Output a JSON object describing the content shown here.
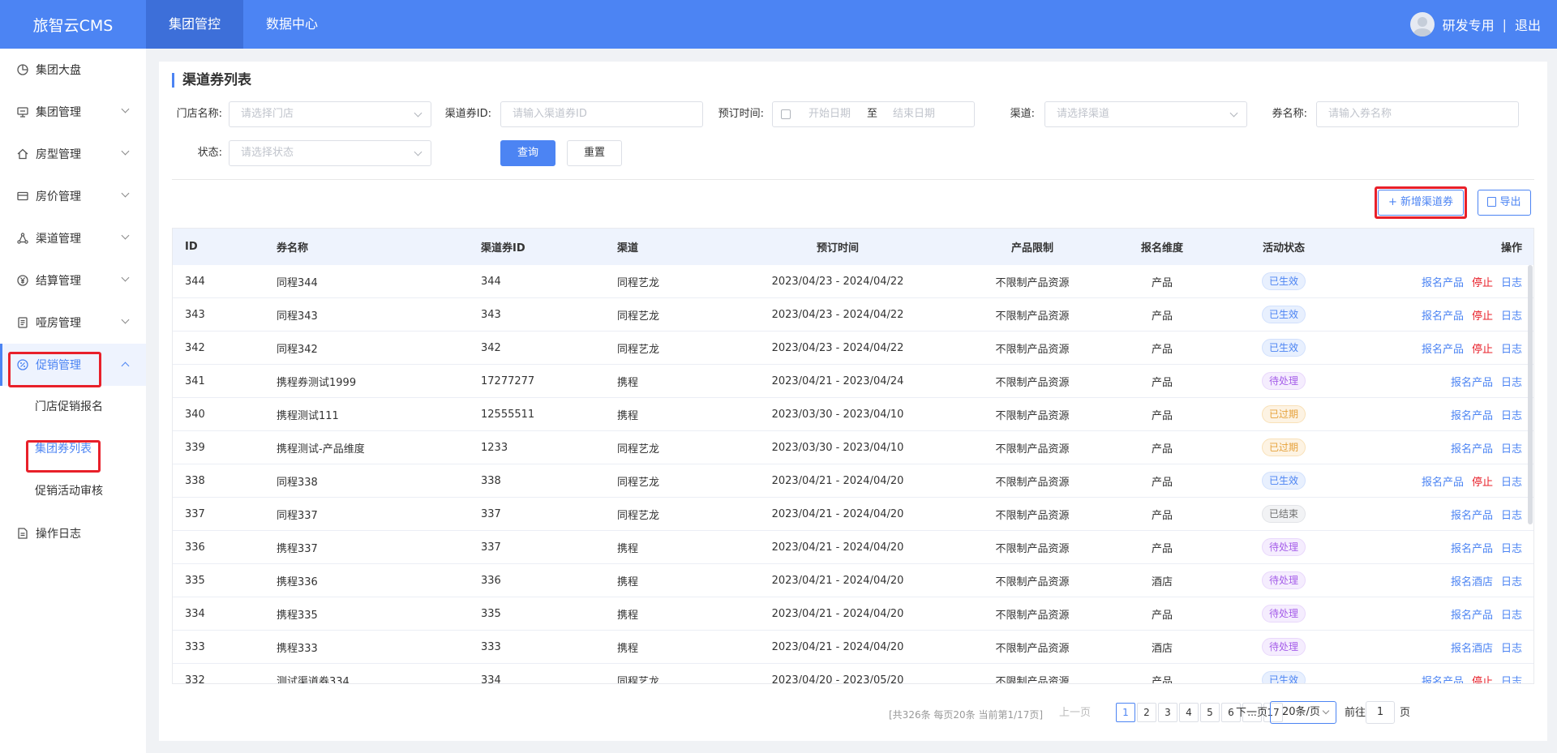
{
  "header": {
    "logo": "旅智云CMS",
    "nav": [
      {
        "label": "集团管控",
        "active": true
      },
      {
        "label": "数据中心",
        "active": false
      }
    ],
    "user_name": "研发专用",
    "separator": "|",
    "logout": "退出"
  },
  "sidebar": {
    "items": [
      {
        "label": "集团大盘",
        "icon": "pie-chart-icon"
      },
      {
        "label": "集团管理",
        "icon": "monitor-icon"
      },
      {
        "label": "房型管理",
        "icon": "home-icon"
      },
      {
        "label": "房价管理",
        "icon": "card-icon"
      },
      {
        "label": "渠道管理",
        "icon": "network-icon"
      },
      {
        "label": "结算管理",
        "icon": "yen-icon"
      },
      {
        "label": "哑房管理",
        "icon": "document-icon"
      },
      {
        "label": "促销管理",
        "icon": "promo-icon"
      }
    ],
    "submenu": [
      "门店促销报名",
      "集团券列表",
      "促销活动审核"
    ],
    "bottom_item": {
      "label": "操作日志",
      "icon": "log-icon"
    }
  },
  "page": {
    "title": "渠道券列表"
  },
  "filters": {
    "store_label": "门店名称:",
    "store_placeholder": "请选择门店",
    "coupon_id_label": "渠道券ID:",
    "coupon_id_placeholder": "请输入渠道券ID",
    "booking_label": "预订时间:",
    "start_placeholder": "开始日期",
    "to": "至",
    "end_placeholder": "结束日期",
    "channel_label": "渠道:",
    "channel_placeholder": "请选择渠道",
    "coupon_name_label": "券名称:",
    "coupon_name_placeholder": "请输入券名称",
    "status_label": "状态:",
    "status_placeholder": "请选择状态",
    "search_btn": "查询",
    "reset_btn": "重置"
  },
  "toolbar": {
    "add_btn": "+ 新增渠道券",
    "export_btn": "导出"
  },
  "table": {
    "columns": [
      "ID",
      "券名称",
      "渠道券ID",
      "渠道",
      "预订时间",
      "产品限制",
      "报名维度",
      "活动状态",
      "操作"
    ],
    "rows": [
      {
        "id": "344",
        "name": "同程344",
        "cid": "344",
        "channel": "同程艺龙",
        "time": "2023/04/23 - 2024/04/22",
        "limit": "不限制产品资源",
        "dim": "产品",
        "status": "已生效",
        "status_type": "blue",
        "ops": [
          "报名产品",
          "停止",
          "日志"
        ]
      },
      {
        "id": "343",
        "name": "同程343",
        "cid": "343",
        "channel": "同程艺龙",
        "time": "2023/04/23 - 2024/04/22",
        "limit": "不限制产品资源",
        "dim": "产品",
        "status": "已生效",
        "status_type": "blue",
        "ops": [
          "报名产品",
          "停止",
          "日志"
        ]
      },
      {
        "id": "342",
        "name": "同程342",
        "cid": "342",
        "channel": "同程艺龙",
        "time": "2023/04/23 - 2024/04/22",
        "limit": "不限制产品资源",
        "dim": "产品",
        "status": "已生效",
        "status_type": "blue",
        "ops": [
          "报名产品",
          "停止",
          "日志"
        ]
      },
      {
        "id": "341",
        "name": "携程券测试1999",
        "cid": "17277277",
        "channel": "携程",
        "time": "2023/04/21 - 2023/04/24",
        "limit": "不限制产品资源",
        "dim": "产品",
        "status": "待处理",
        "status_type": "purple",
        "ops": [
          "报名产品",
          "日志"
        ]
      },
      {
        "id": "340",
        "name": "携程测试111",
        "cid": "12555511",
        "channel": "携程",
        "time": "2023/03/30 - 2023/04/10",
        "limit": "不限制产品资源",
        "dim": "产品",
        "status": "已过期",
        "status_type": "orange",
        "ops": [
          "报名产品",
          "日志"
        ]
      },
      {
        "id": "339",
        "name": "携程测试-产品维度",
        "cid": "1233",
        "channel": "同程艺龙",
        "time": "2023/03/30 - 2023/04/10",
        "limit": "不限制产品资源",
        "dim": "产品",
        "status": "已过期",
        "status_type": "orange",
        "ops": [
          "报名产品",
          "日志"
        ]
      },
      {
        "id": "338",
        "name": "同程338",
        "cid": "338",
        "channel": "同程艺龙",
        "time": "2023/04/21 - 2024/04/20",
        "limit": "不限制产品资源",
        "dim": "产品",
        "status": "已生效",
        "status_type": "blue",
        "ops": [
          "报名产品",
          "停止",
          "日志"
        ]
      },
      {
        "id": "337",
        "name": "同程337",
        "cid": "337",
        "channel": "同程艺龙",
        "time": "2023/04/21 - 2024/04/20",
        "limit": "不限制产品资源",
        "dim": "产品",
        "status": "已结束",
        "status_type": "gray",
        "ops": [
          "报名产品",
          "日志"
        ]
      },
      {
        "id": "336",
        "name": "携程337",
        "cid": "337",
        "channel": "携程",
        "time": "2023/04/21 - 2024/04/20",
        "limit": "不限制产品资源",
        "dim": "产品",
        "status": "待处理",
        "status_type": "purple",
        "ops": [
          "报名产品",
          "日志"
        ]
      },
      {
        "id": "335",
        "name": "携程336",
        "cid": "336",
        "channel": "携程",
        "time": "2023/04/21 - 2024/04/20",
        "limit": "不限制产品资源",
        "dim": "酒店",
        "status": "待处理",
        "status_type": "purple",
        "ops": [
          "报名酒店",
          "日志"
        ]
      },
      {
        "id": "334",
        "name": "携程335",
        "cid": "335",
        "channel": "携程",
        "time": "2023/04/21 - 2024/04/20",
        "limit": "不限制产品资源",
        "dim": "产品",
        "status": "待处理",
        "status_type": "purple",
        "ops": [
          "报名产品",
          "日志"
        ]
      },
      {
        "id": "333",
        "name": "携程333",
        "cid": "333",
        "channel": "携程",
        "time": "2023/04/21 - 2024/04/20",
        "limit": "不限制产品资源",
        "dim": "酒店",
        "status": "待处理",
        "status_type": "purple",
        "ops": [
          "报名酒店",
          "日志"
        ]
      },
      {
        "id": "332",
        "name": "测试渠道券334",
        "cid": "334",
        "channel": "同程艺龙",
        "time": "2023/04/20 - 2023/05/20",
        "limit": "不限制产品资源",
        "dim": "产品",
        "status": "已生效",
        "status_type": "blue",
        "ops": [
          "报名产品",
          "停止",
          "日志"
        ]
      }
    ]
  },
  "pagination": {
    "summary": "[共326条 每页20条 当前第1/17页]",
    "prev": "上一页",
    "pages": [
      "1",
      "2",
      "3",
      "4",
      "5",
      "6",
      "...",
      "17"
    ],
    "active_page": "1",
    "next": "下一页",
    "page_size": "20条/页",
    "goto_label": "前往",
    "goto_value": "1",
    "page_suffix": "页"
  },
  "colors": {
    "primary": "#4c84f3",
    "danger": "#e8202a"
  }
}
